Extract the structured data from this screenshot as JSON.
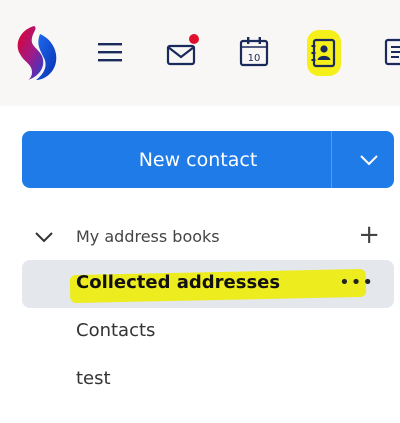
{
  "toolbar": {
    "calendar_day": "10",
    "mail_badge_color": "#e0102a",
    "contacts_highlight_color": "#f5f01a",
    "icons": [
      "swisscom-logo",
      "menu-icon",
      "mail-icon",
      "calendar-icon",
      "contacts-icon",
      "document-icon"
    ]
  },
  "new_contact": {
    "label": "New contact",
    "accent": "#1f7be8"
  },
  "address_books": {
    "section_title": "My address books",
    "add_symbol": "+",
    "items": [
      {
        "label": "Collected addresses",
        "selected": true,
        "more": "•••"
      },
      {
        "label": "Contacts"
      },
      {
        "label": "test"
      }
    ]
  }
}
